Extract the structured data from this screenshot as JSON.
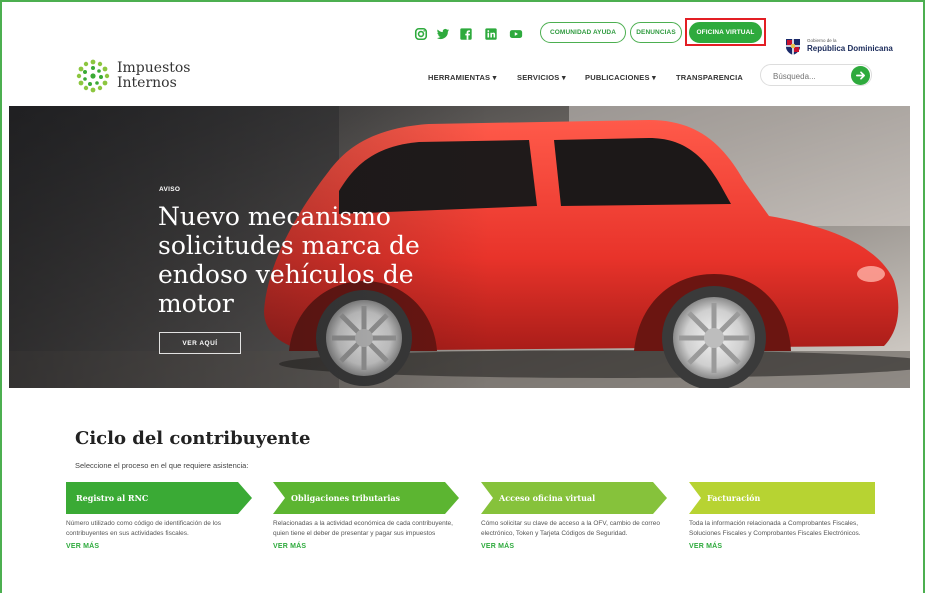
{
  "topbar": {
    "social": [
      "instagram-icon",
      "twitter-icon",
      "facebook-icon",
      "linkedin-icon",
      "youtube-icon"
    ],
    "community_label": "COMUNIDAD AYUDA",
    "complaints_label": "DENUNCIAS",
    "virtual_office_label": "OFICINA VIRTUAL",
    "gov_small": "Gobierno de la",
    "gov_name": "República Dominicana"
  },
  "header": {
    "logo_line1": "Impuestos",
    "logo_line2": "Internos",
    "nav": [
      "HERRAMIENTAS",
      "SERVICIOS",
      "PUBLICACIONES",
      "TRANSPARENCIA"
    ],
    "search_placeholder": "Búsqueda..."
  },
  "hero": {
    "tag": "AVISO",
    "title": "Nuevo mecanismo solicitudes marca de endoso vehículos de motor",
    "button_label": "VER AQUÍ"
  },
  "ciclo": {
    "title": "Ciclo del contribuyente",
    "subtitle": "Seleccione el proceso en el que requiere asistencia:",
    "steps": [
      {
        "title": "Registro al RNC",
        "desc": "Número utilizado como código de identificación de los contribuyentes en sus actividades fiscales.",
        "more": "VER MÁS",
        "color": "#3aaa35"
      },
      {
        "title": "Obligaciones tributarias",
        "desc": "Relacionadas a la actividad económica de cada contribuyente, quien tiene el deber de presentar y pagar sus impuestos",
        "more": "VER MÁS",
        "color": "#5cb531"
      },
      {
        "title": "Acceso oficina virtual",
        "desc": "Cómo solicitar su clave de acceso a la OFV, cambio de correo electrónico, Token y Tarjeta Códigos de Seguridad.",
        "more": "VER MÁS",
        "color": "#86c23b"
      },
      {
        "title": "Facturación",
        "desc": "Toda la información relacionada a Comprobantes Fiscales, Soluciones Fiscales y Comprobantes Fiscales Electrónicos.",
        "more": "VER MÁS",
        "color": "#b7d332"
      }
    ]
  },
  "colors": {
    "brand_green": "#2eaa3d",
    "highlight_red": "#e31e24"
  }
}
